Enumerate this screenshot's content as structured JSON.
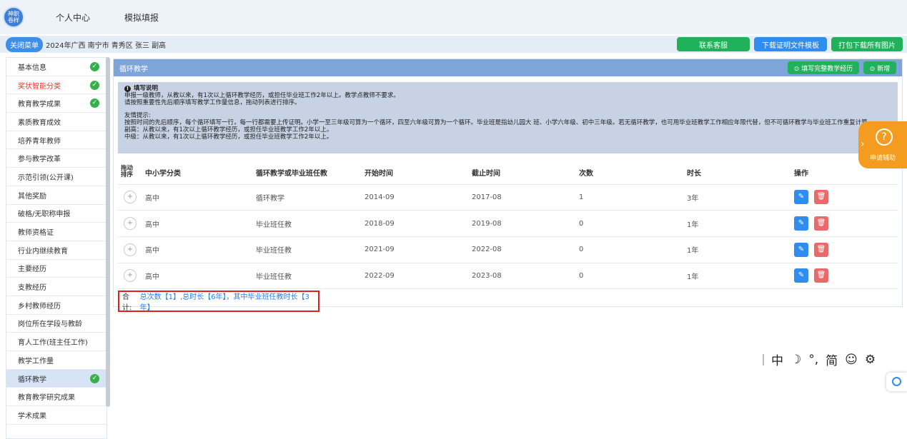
{
  "topbar": {
    "logo_text": "神职\n卷样",
    "nav": [
      "个人中心",
      "模拟填报"
    ]
  },
  "subbar": {
    "close_menu": "关闭菜单",
    "crumb": "2024年广西 南宁市 青秀区 张三 副高",
    "actions": [
      "联系客服",
      "下载证明文件模板",
      "打包下载所有图片"
    ]
  },
  "sidebar": {
    "items": [
      {
        "label": "基本信息",
        "checked": true
      },
      {
        "label": "奖状智能分类",
        "checked": true,
        "warn": true
      },
      {
        "label": "教育教学成果",
        "checked": true
      },
      {
        "label": "素质教育成效",
        "checked": false
      },
      {
        "label": "培养青年教师",
        "checked": false
      },
      {
        "label": "参与教学改革",
        "checked": false
      },
      {
        "label": "示范引领(公开课)",
        "checked": false
      },
      {
        "label": "其他奖励",
        "checked": false
      },
      {
        "label": "破格/无职称申报",
        "checked": false
      },
      {
        "label": "教师资格证",
        "checked": false
      },
      {
        "label": "行业内继续教育",
        "checked": false
      },
      {
        "label": "主要经历",
        "checked": false
      },
      {
        "label": "支教经历",
        "checked": false
      },
      {
        "label": "乡村教师经历",
        "checked": false
      },
      {
        "label": "岗位所在学段与教龄",
        "checked": false
      },
      {
        "label": "育人工作(班主任工作)",
        "checked": false
      },
      {
        "label": "教学工作量",
        "checked": false
      },
      {
        "label": "循环教学",
        "checked": true,
        "active": true
      },
      {
        "label": "教育教学研究成果",
        "checked": false
      },
      {
        "label": "学术成果",
        "checked": false
      }
    ]
  },
  "panel": {
    "title": "循环教学",
    "btn_fill": "⊙ 填写完整教学经历",
    "btn_add": "⊙ 新增"
  },
  "notice": {
    "title": "填写说明",
    "lines1": [
      "申报一级教师，从教以来，有1次以上循环教学经历，或担任毕业班工作2年以上。教学点教师不要求。",
      "请按照重要性先后顺序填写教学工作量信息，拖动列表进行排序。"
    ],
    "tip_title": "友情提示:",
    "lines2": [
      "按照时间的先后顺序，每个循环填写一行，每一行都需要上传证明。小学一至三年级可算为一个循环，四至六年级可算为一个循环。毕业班是指幼儿园大 班、小学六年级、初中三年级。若无循环教学，也可用毕业班教学工作相应年限代替，但不可循环教学与毕业班工作重复计算。",
      "副高：从教以来，有1次以上循环教学经历，或担任毕业班教学工作2年以上。",
      "中级：从教以来，有1次以上循环教学经历，或担任毕业班教学工作2年以上。"
    ]
  },
  "table": {
    "headers": [
      "拖动\n排序",
      "中小学分类",
      "循环教学或毕业班任教",
      "开始时间",
      "截止时间",
      "次数",
      "时长",
      "操作"
    ],
    "rows": [
      [
        "高中",
        "循环教学",
        "2014-09",
        "2017-08",
        "1",
        "3年"
      ],
      [
        "高中",
        "毕业班任教",
        "2018-09",
        "2019-08",
        "0",
        "1年"
      ],
      [
        "高中",
        "毕业班任教",
        "2021-09",
        "2022-08",
        "0",
        "1年"
      ],
      [
        "高中",
        "毕业班任教",
        "2022-09",
        "2023-08",
        "0",
        "1年"
      ]
    ]
  },
  "summary": {
    "label": "合计:",
    "value": "总次数【1】,总时长【6年】，其中毕业班任教时长【3年】"
  },
  "help": {
    "label": "申请辅助"
  },
  "ime": [
    "中",
    "☽",
    "°,",
    "简",
    "☺",
    "⚙"
  ]
}
